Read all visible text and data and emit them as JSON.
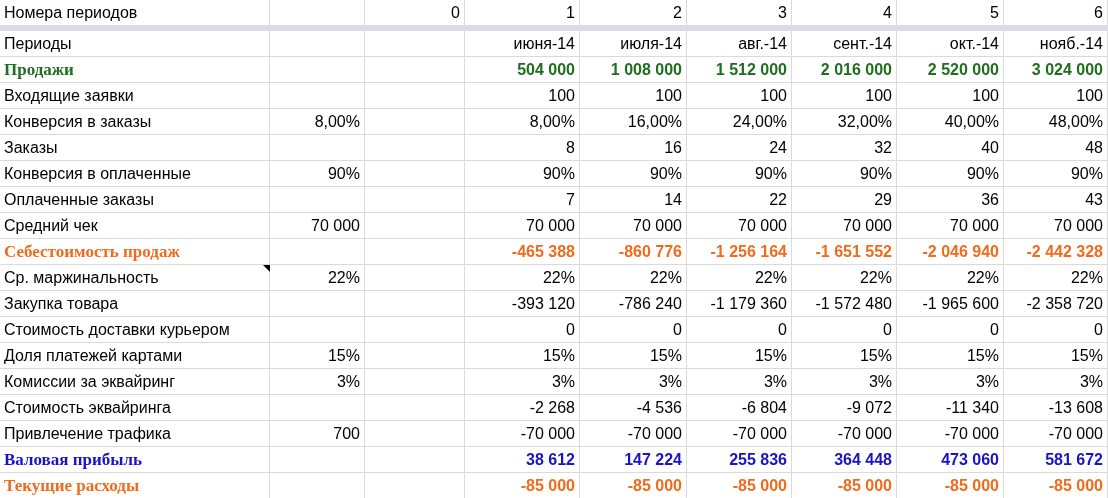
{
  "header_row": {
    "label": "Номера периодов",
    "column_3": "0",
    "periods": [
      "1",
      "2",
      "3",
      "4",
      "5",
      "6"
    ]
  },
  "rows": [
    {
      "label": "Периоды",
      "kind": "plain",
      "comment": false,
      "values": [
        "июня-14",
        "июля-14",
        "авг.-14",
        "сент.-14",
        "окт.-14",
        "нояб.-14"
      ]
    },
    {
      "label": "Продажи",
      "kind": "green",
      "comment": false,
      "values": [
        "504 000",
        "1 008 000",
        "1 512 000",
        "2 016 000",
        "2 520 000",
        "3 024 000"
      ]
    },
    {
      "label": "Входящие заявки",
      "kind": "plain",
      "comment": false,
      "values": [
        "100",
        "100",
        "100",
        "100",
        "100",
        "100"
      ]
    },
    {
      "label": "Конверсия в заказы",
      "kind": "plain",
      "comment": false,
      "param": "8,00%",
      "values": [
        "8,00%",
        "16,00%",
        "24,00%",
        "32,00%",
        "40,00%",
        "48,00%"
      ]
    },
    {
      "label": "Заказы",
      "kind": "plain",
      "comment": false,
      "values": [
        "8",
        "16",
        "24",
        "32",
        "40",
        "48"
      ]
    },
    {
      "label": "Конверсия в оплаченные",
      "kind": "plain",
      "comment": false,
      "param": "90%",
      "values": [
        "90%",
        "90%",
        "90%",
        "90%",
        "90%",
        "90%"
      ]
    },
    {
      "label": "Оплаченные заказы",
      "kind": "plain",
      "comment": false,
      "values": [
        "7",
        "14",
        "22",
        "29",
        "36",
        "43"
      ]
    },
    {
      "label": "Средний чек",
      "kind": "plain",
      "comment": false,
      "param": "70 000",
      "values": [
        "70 000",
        "70 000",
        "70 000",
        "70 000",
        "70 000",
        "70 000"
      ]
    },
    {
      "label": "Себестоимость продаж",
      "kind": "orange",
      "comment": false,
      "values": [
        "-465 388",
        "-860 776",
        "-1 256 164",
        "-1 651 552",
        "-2 046 940",
        "-2 442 328"
      ]
    },
    {
      "label": "Ср. маржинальность",
      "kind": "plain",
      "comment": true,
      "param": "22%",
      "values": [
        "22%",
        "22%",
        "22%",
        "22%",
        "22%",
        "22%"
      ]
    },
    {
      "label": "Закупка товара",
      "kind": "plain",
      "comment": false,
      "values": [
        "-393 120",
        "-786 240",
        "-1 179 360",
        "-1 572 480",
        "-1 965 600",
        "-2 358 720"
      ]
    },
    {
      "label": "Стоимость доставки курьером",
      "kind": "plain",
      "comment": false,
      "values": [
        "0",
        "0",
        "0",
        "0",
        "0",
        "0"
      ]
    },
    {
      "label": "Доля платежей картами",
      "kind": "plain",
      "comment": false,
      "param": "15%",
      "values": [
        "15%",
        "15%",
        "15%",
        "15%",
        "15%",
        "15%"
      ]
    },
    {
      "label": "Комиссии за эквайринг",
      "kind": "plain",
      "comment": false,
      "param": "3%",
      "values": [
        "3%",
        "3%",
        "3%",
        "3%",
        "3%",
        "3%"
      ]
    },
    {
      "label": "Стоимость эквайринга",
      "kind": "plain",
      "comment": false,
      "values": [
        "-2 268",
        "-4 536",
        "-6 804",
        "-9 072",
        "-11 340",
        "-13 608"
      ]
    },
    {
      "label": "Привлечение трафика",
      "kind": "plain",
      "comment": false,
      "param": "700",
      "values": [
        "-70 000",
        "-70 000",
        "-70 000",
        "-70 000",
        "-70 000",
        "-70 000"
      ]
    },
    {
      "label": "Валовая прибыль",
      "kind": "blue",
      "comment": false,
      "values": [
        "38 612",
        "147 224",
        "255 836",
        "364 448",
        "473 060",
        "581 672"
      ]
    },
    {
      "label": "Текущие расходы",
      "kind": "orange",
      "comment": false,
      "values": [
        "-85 000",
        "-85 000",
        "-85 000",
        "-85 000",
        "-85 000",
        "-85 000"
      ]
    }
  ]
}
